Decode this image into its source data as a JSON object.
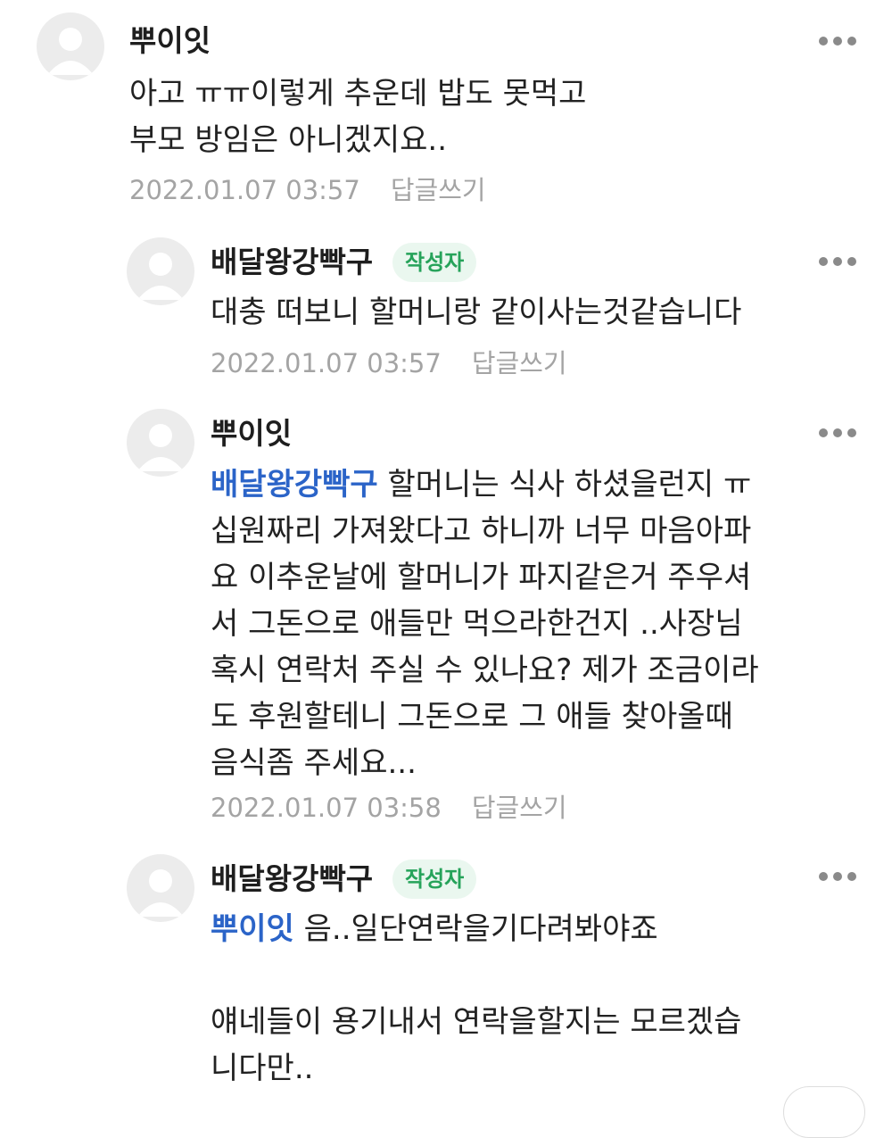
{
  "comments": [
    {
      "author": "뿌이잇",
      "badge": "",
      "mention": "",
      "text": "아고 ㅠㅠ이렇게 추운데 밥도 못먹고\n부모 방임은 아니겠지요..",
      "date": "2022.01.07 03:57",
      "reply_label": "답글쓰기"
    },
    {
      "author": "배달왕강빡구",
      "badge": "작성자",
      "mention": "",
      "text": "대충 떠보니 할머니랑 같이사는것같습니다",
      "date": "2022.01.07 03:57",
      "reply_label": "답글쓰기"
    },
    {
      "author": "뿌이잇",
      "badge": "",
      "mention": "배달왕강빡구",
      "text": " 할머니는 식사 하셨을런지 ㅠ\n십원짜리 가져왔다고 하니까 너무 마음아파\n요 이추운날에 할머니가 파지같은거 주우셔\n서 그돈으로 애들만 먹으라한건지 ..사장님\n혹시 연락처 주실 수 있나요? 제가 조금이라\n도 후원할테니 그돈으로 그 애들 찾아올때\n음식좀 주세요...",
      "date": "2022.01.07 03:58",
      "reply_label": "답글쓰기"
    },
    {
      "author": "배달왕강빡구",
      "badge": "작성자",
      "mention": "뿌이잇",
      "text": " 음..일단연락을기다려봐야죠\n\n얘네들이 용기내서 연락을할지는 모르겠습\n니다만..",
      "date": "",
      "reply_label": ""
    }
  ]
}
